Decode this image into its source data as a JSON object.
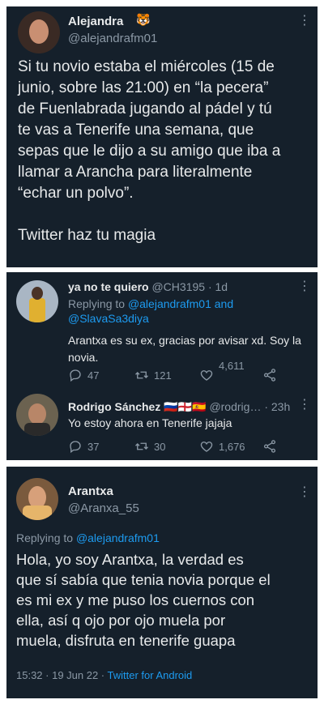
{
  "tweet": {
    "name": "Alejandra",
    "name_emoji": "🐯",
    "handle": "@alejandrafm01",
    "text": "Si tu novio estaba el miércoles (15 de\njunio, sobre las 21:00) en “la pecera”\nde Fuenlabrada jugando al pádel y tú\nte vas a Tenerife una semana, que\nsepas que le dijo a su amigo que iba a\nllamar a Arancha para literalmente\n“echar un polvo”.\n\nTwitter haz tu magia"
  },
  "reply1": {
    "name": "ya no te quiero",
    "handle": "@CH3195",
    "time": "· 1d",
    "replying_prefix": "Replying to ",
    "replying_to_1": "@alejandrafm01",
    "replying_and": " and",
    "replying_to_2": "@SlavaSa3diya",
    "text": "Arantxa es su ex, gracias por avisar xd. Soy la novia.",
    "replies": "47",
    "retweets": "121",
    "likes": "4,611"
  },
  "reply2": {
    "name": "Rodrigo Sánchez",
    "flags": "🇷🇺🏴󠁧󠁢󠁥󠁮󠁧󠁿🇪🇸",
    "handle": "@rodrig…",
    "time": "· 23h",
    "text": "Yo estoy ahora en Tenerife jajaja",
    "replies": "37",
    "retweets": "30",
    "likes": "1,676"
  },
  "tweet3": {
    "name": "Arantxa",
    "handle": "@Aranxa_55",
    "replying_prefix": "Replying to ",
    "replying_to": "@alejandrafm01",
    "text": "Hola, yo soy Arantxa, la verdad es\nque sí sabía que tenia novia porque el\nes mi ex y me puso los cuernos con\nella, así q ojo por ojo muela por\nmuela, disfruta en tenerife guapa",
    "timestamp": "15:32 · 19 Jun 22 · ",
    "source": "Twitter for Android"
  },
  "icons": {
    "more": "more-icon",
    "reply": "reply-icon",
    "retweet": "retweet-icon",
    "like": "like-icon",
    "share": "share-icon"
  },
  "colors": {
    "background": "#15202b",
    "text": "#e7e9ea",
    "muted": "#8b98a5",
    "link": "#1d9bf0"
  }
}
